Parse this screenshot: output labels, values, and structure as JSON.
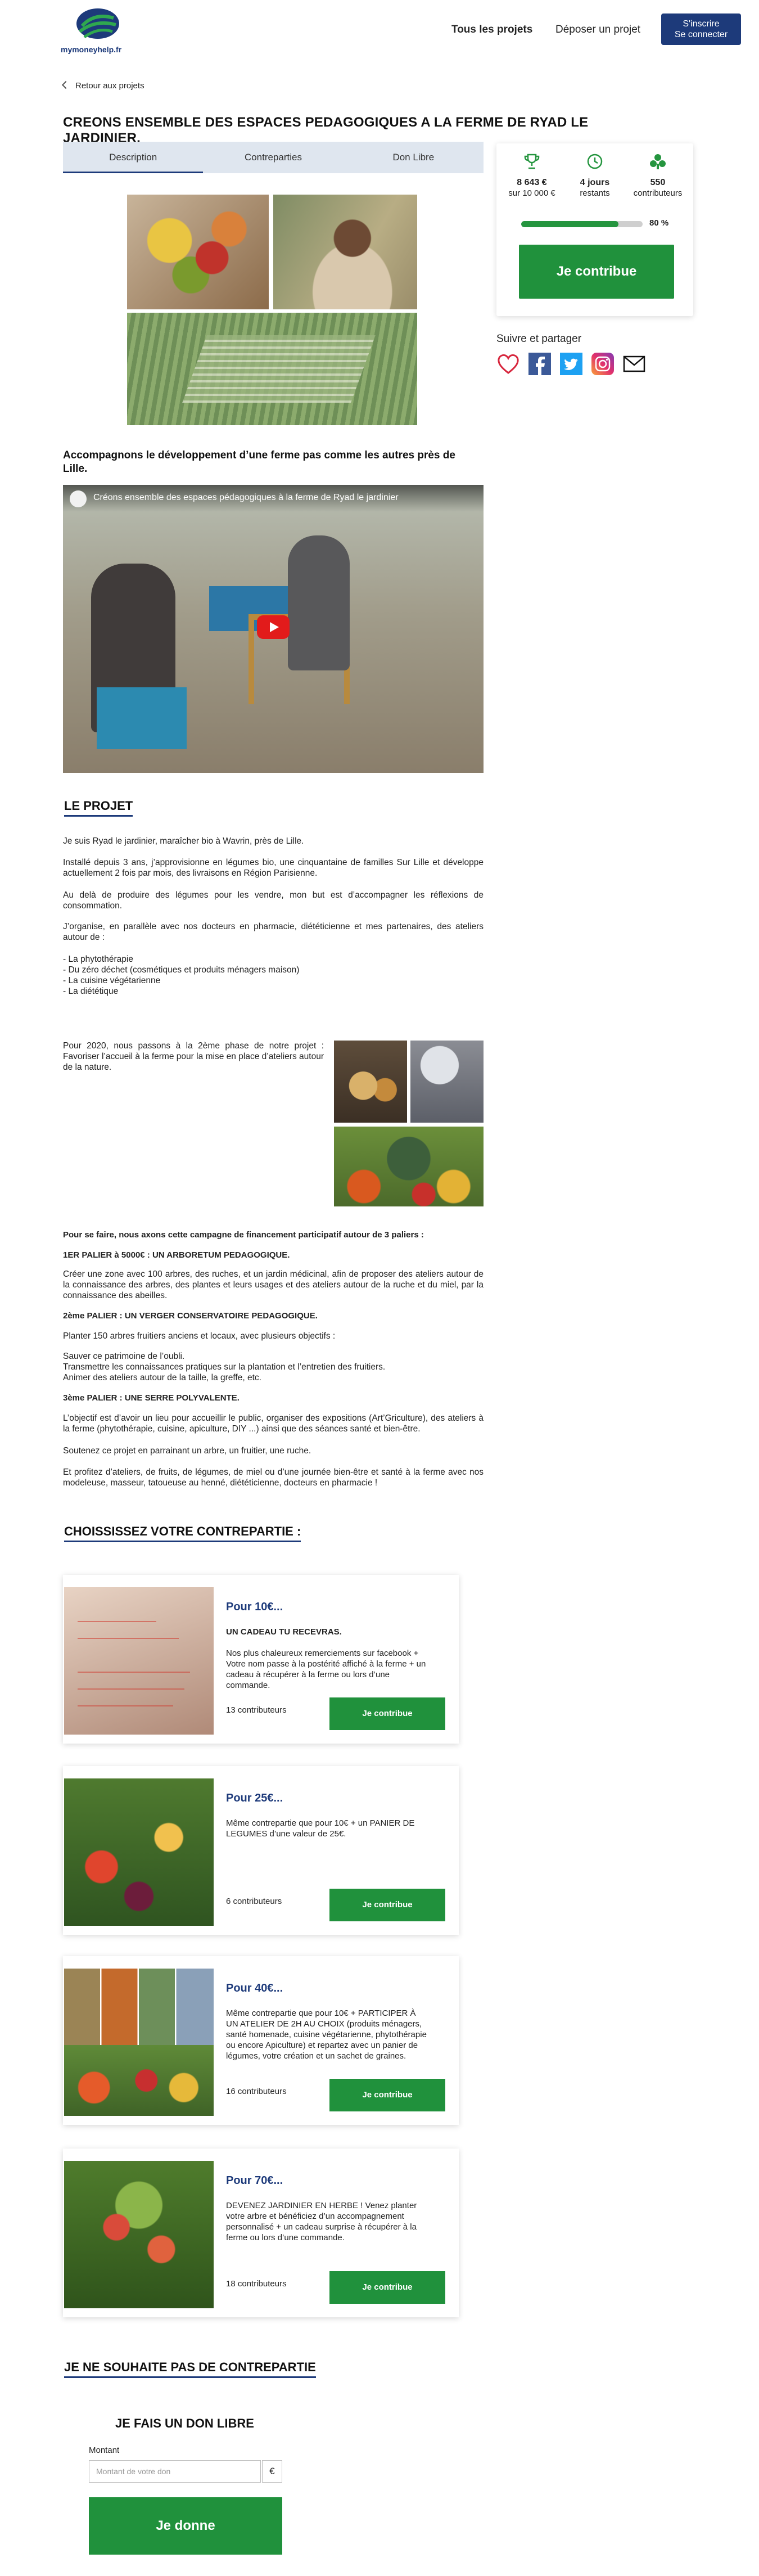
{
  "header": {
    "logo_text": "mymoneyhelp.fr",
    "nav_projects": "Tous les projets",
    "nav_deposit": "Déposer un projet",
    "signup_line1": "S'inscrire",
    "signup_line2": "Se connecter",
    "brand_color": "#1d3a7a"
  },
  "back_link": "Retour aux projets",
  "title": "CREONS ENSEMBLE DES ESPACES PEDAGOGIQUES A LA FERME DE RYAD LE JARDINIER.",
  "tabs": [
    {
      "label": "Description",
      "active": true
    },
    {
      "label": "Contreparties",
      "active": false
    },
    {
      "label": "Don Libre",
      "active": false
    }
  ],
  "stats": {
    "funds_value": "8 643 €",
    "funds_goal": "sur 10 000 €",
    "days_value": "4 jours",
    "days_label": "restants",
    "contrib_value": "550",
    "contrib_label": "contributeurs",
    "progress_percent": 80,
    "progress_label": "80 %",
    "contribute_label": "Je contribue",
    "accent_color": "#20913c"
  },
  "share": {
    "title": "Suivre et partager",
    "icons": [
      "heart-icon",
      "facebook-icon",
      "twitter-icon",
      "instagram-icon",
      "mail-icon"
    ]
  },
  "subtitle": "Accompagnons le développement d’une ferme pas comme  les autres près de Lille.",
  "video": {
    "title": "Créons ensemble des espaces pédagogiques à la ferme de Ryad le jardinier"
  },
  "project": {
    "heading": "LE PROJET",
    "p1": "Je suis Ryad le jardinier, maraîcher bio à Wavrin, près de Lille.",
    "p2": "Installé depuis 3 ans, j’approvisionne en légumes bio, une cinquantaine de familles Sur Lille et développe actuellement 2 fois par mois, des livraisons en Région Parisienne.",
    "p3": "Au delà de produire des légumes pour les vendre, mon but est d’accompagner les réflexions de consommation.",
    "p4": "J’organise, en parallèle avec nos docteurs en pharmacie, diététicienne et mes partenaires, des ateliers autour de :",
    "list": [
      "- La phytothérapie",
      "- Du zéro déchet (cosmétiques et produits ménagers maison)",
      "- La cuisine végétarienne",
      "- La diététique"
    ],
    "phase": "Pour 2020, nous passons à la 2ème phase de notre projet : Favoriser l’accueil à la ferme pour la mise en place d’ateliers autour de la nature.",
    "tiers_intro": "Pour se faire, nous axons cette campagne de financement participatif autour de 3 paliers :",
    "tier1_title": "1ER PALIER à 5000€ : UN ARBORETUM PEDAGOGIQUE.",
    "tier1_text": "Créer une zone avec 100 arbres, des ruches, et un jardin médicinal, afin de proposer des ateliers autour de la connaissance des arbres, des plantes et leurs usages et des ateliers autour de la ruche et du miel, par la connaissance des abeilles.",
    "tier2_title": "2ème PALIER : UN VERGER CONSERVATOIRE PEDAGOGIQUE.",
    "tier2_text1": "Planter 150 arbres fruitiers anciens et locaux, avec plusieurs objectifs :",
    "tier2_text2": "Sauver ce patrimoine de l’oubli.",
    "tier2_text3": "Transmettre les connaissances pratiques sur la plantation et l’entretien des fruitiers.",
    "tier2_text4": "Animer des ateliers autour de la taille, la greffe, etc.",
    "tier3_title": "3ème PALIER : UNE SERRE POLYVALENTE.",
    "tier3_text": "L’objectif est d’avoir un lieu pour accueillir le public, organiser des expositions (Art’Griculture), des ateliers à la ferme  (phytothérapie, cuisine, apiculture, DIY ...) ainsi que des séances santé et bien-être.",
    "support1": "Soutenez ce projet en parrainant un arbre, un fruitier, une ruche.",
    "support2": "Et profitez d’ateliers, de fruits, de légumes, de miel ou d’une journée bien-être et santé à la ferme avec nos modeleuse, masseur, tatoueuse au henné, diététicienne, docteurs en pharmacie !"
  },
  "rewards": {
    "heading": "CHOISSISSEZ VOTRE CONTREPARTIE :",
    "items": [
      {
        "price": "Pour 10€...",
        "title": "UN CADEAU TU RECEVRAS.",
        "desc": "Nos plus chaleureux remerciements sur facebook + Votre nom passe à la postérité affiché à la ferme + un cadeau à récupérer à la ferme ou lors d’une commande.",
        "count": "13 contributeurs",
        "button": "Je contribue"
      },
      {
        "price": "Pour 25€...",
        "title": "",
        "desc": "Même contrepartie que pour 10€ + un PANIER DE LEGUMES d’une valeur de 25€.",
        "count": "6 contributeurs",
        "button": "Je contribue"
      },
      {
        "price": "Pour 40€...",
        "title": "",
        "desc": "Même contrepartie que pour 10€ + PARTICIPER À UN ATELIER DE 2H AU CHOIX (produits ménagers, santé homenade, cuisine végétarienne, phytothérapie ou encore Apiculture) et repartez avec un panier de légumes, votre création et un sachet de graines.",
        "count": "16 contributeurs",
        "button": "Je contribue"
      },
      {
        "price": "Pour 70€...",
        "title": "",
        "desc": "DEVENEZ JARDINIER EN HERBE ! Venez planter votre arbre et bénéficiez d’un accompagnement personnalisé + un cadeau surprise à récupérer à la ferme ou lors d’une commande.",
        "count": "18 contributeurs",
        "button": "Je contribue"
      }
    ]
  },
  "no_reward": {
    "heading": "JE NE SOUHAITE PAS DE CONTREPARTIE",
    "title": "JE FAIS UN DON LIBRE",
    "amount_label": "Montant",
    "amount_placeholder": "Montant de votre don",
    "currency": "€",
    "button": "Je donne"
  }
}
